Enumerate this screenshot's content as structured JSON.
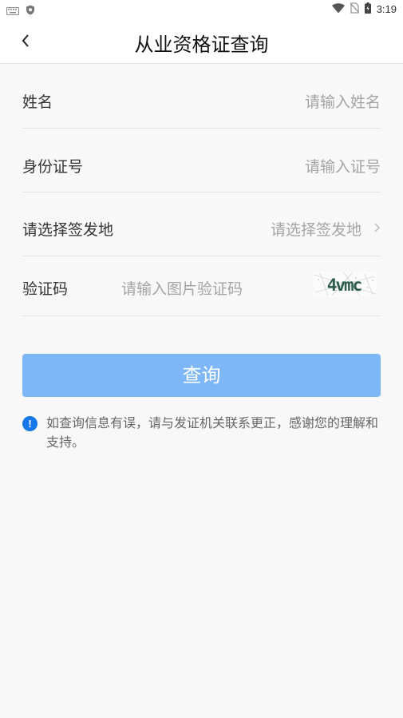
{
  "status_bar": {
    "time": "3:19",
    "icons": [
      "keyboard-icon",
      "shield-notification-icon",
      "wifi-icon",
      "no-sim-icon",
      "battery-icon"
    ]
  },
  "header": {
    "title": "从业资格证查询",
    "back_icon": "chevron-left-icon"
  },
  "form": {
    "name_label": "姓名",
    "name_placeholder": "请输入姓名",
    "id_label": "身份证号",
    "id_placeholder": "请输入证号",
    "place_label": "请选择签发地",
    "place_placeholder": "请选择签发地",
    "captcha_label": "验证码",
    "captcha_placeholder": "请输入图片验证码",
    "captcha_text": "4vmc"
  },
  "submit_label": "查询",
  "notice": "如查询信息有误，请与发证机关联系更正，感谢您的理解和支持。",
  "colors": {
    "button": "#7db7f8",
    "info_icon": "#1677e8",
    "background": "#f8f8f8"
  }
}
